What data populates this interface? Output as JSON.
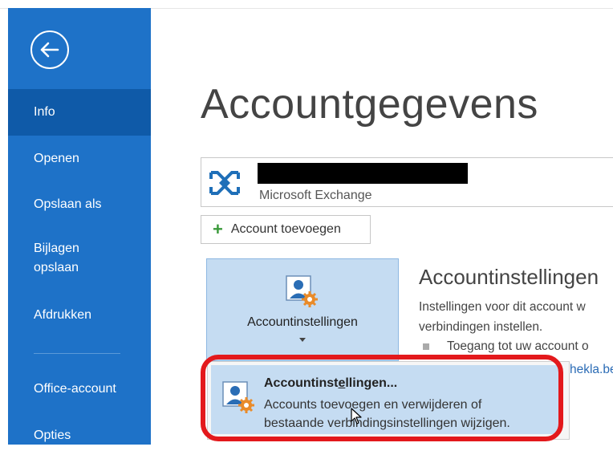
{
  "sidebar": {
    "items": [
      {
        "label": "Info",
        "active": true
      },
      {
        "label": "Openen"
      },
      {
        "label": "Opslaan als"
      },
      {
        "label": "Bijlagen\nopslaan"
      },
      {
        "label": "Afdrukken"
      },
      {
        "label": "Office-account"
      },
      {
        "label": "Opties"
      }
    ],
    "back_icon": "back-arrow-icon"
  },
  "main": {
    "title": "Accountgegevens",
    "account": {
      "email": "",
      "type": "Microsoft Exchange",
      "icon": "exchange-icon"
    },
    "add_account_label": "Account toevoegen",
    "account_settings_button": {
      "label": "Accountinstellingen",
      "icon": "account-settings-icon"
    },
    "settings_section": {
      "title": "Accountinstellingen",
      "desc_line1": "Instellingen voor dit account w",
      "desc_line2": "verbindingen instellen.",
      "bullet": "Toegang tot uw account o",
      "link_fragment": "hekla.be"
    },
    "dropdown": {
      "title_pre": "Accountinst",
      "title_underline": "e",
      "title_post": "llingen...",
      "desc_line1": "Accounts toevoegen en verwijderen of",
      "desc_line2": "bestaande verbindingsinstellingen wijzigen."
    }
  },
  "colors": {
    "sidebar": "#1e72c8",
    "sidebar_active": "#0f5aa8",
    "highlight_border": "#e3191c",
    "selected_bg": "#c5dcf2"
  }
}
